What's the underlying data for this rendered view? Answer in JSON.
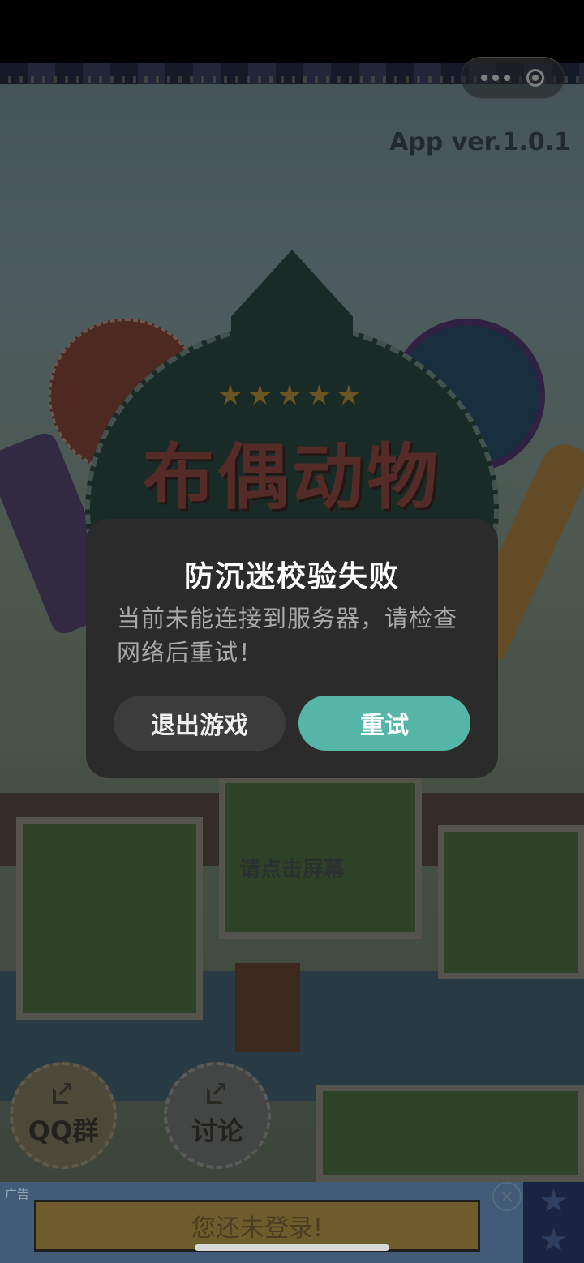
{
  "app": {
    "version_label": "App ver.1.0.1"
  },
  "capsule": {
    "more_icon": "more-dots-icon",
    "close_icon": "target-icon"
  },
  "logo": {
    "title": "布偶动物",
    "stars": "★★★★★"
  },
  "game": {
    "tap_hint": "请点击屏幕",
    "qq_group_label": "QQ群",
    "discuss_label": "讨论"
  },
  "ad": {
    "tag": "广告",
    "banner_text": "您还未登录!",
    "close_glyph": "×"
  },
  "dialog": {
    "title": "防沉迷校验失败",
    "message": "当前未能连接到服务器，请检查网络后重试！",
    "exit_label": "退出游戏",
    "retry_label": "重试"
  },
  "colors": {
    "dialog_bg": "#2b2b2b",
    "retry_button": "#55b6a8",
    "exit_button": "#3c3c3c"
  }
}
